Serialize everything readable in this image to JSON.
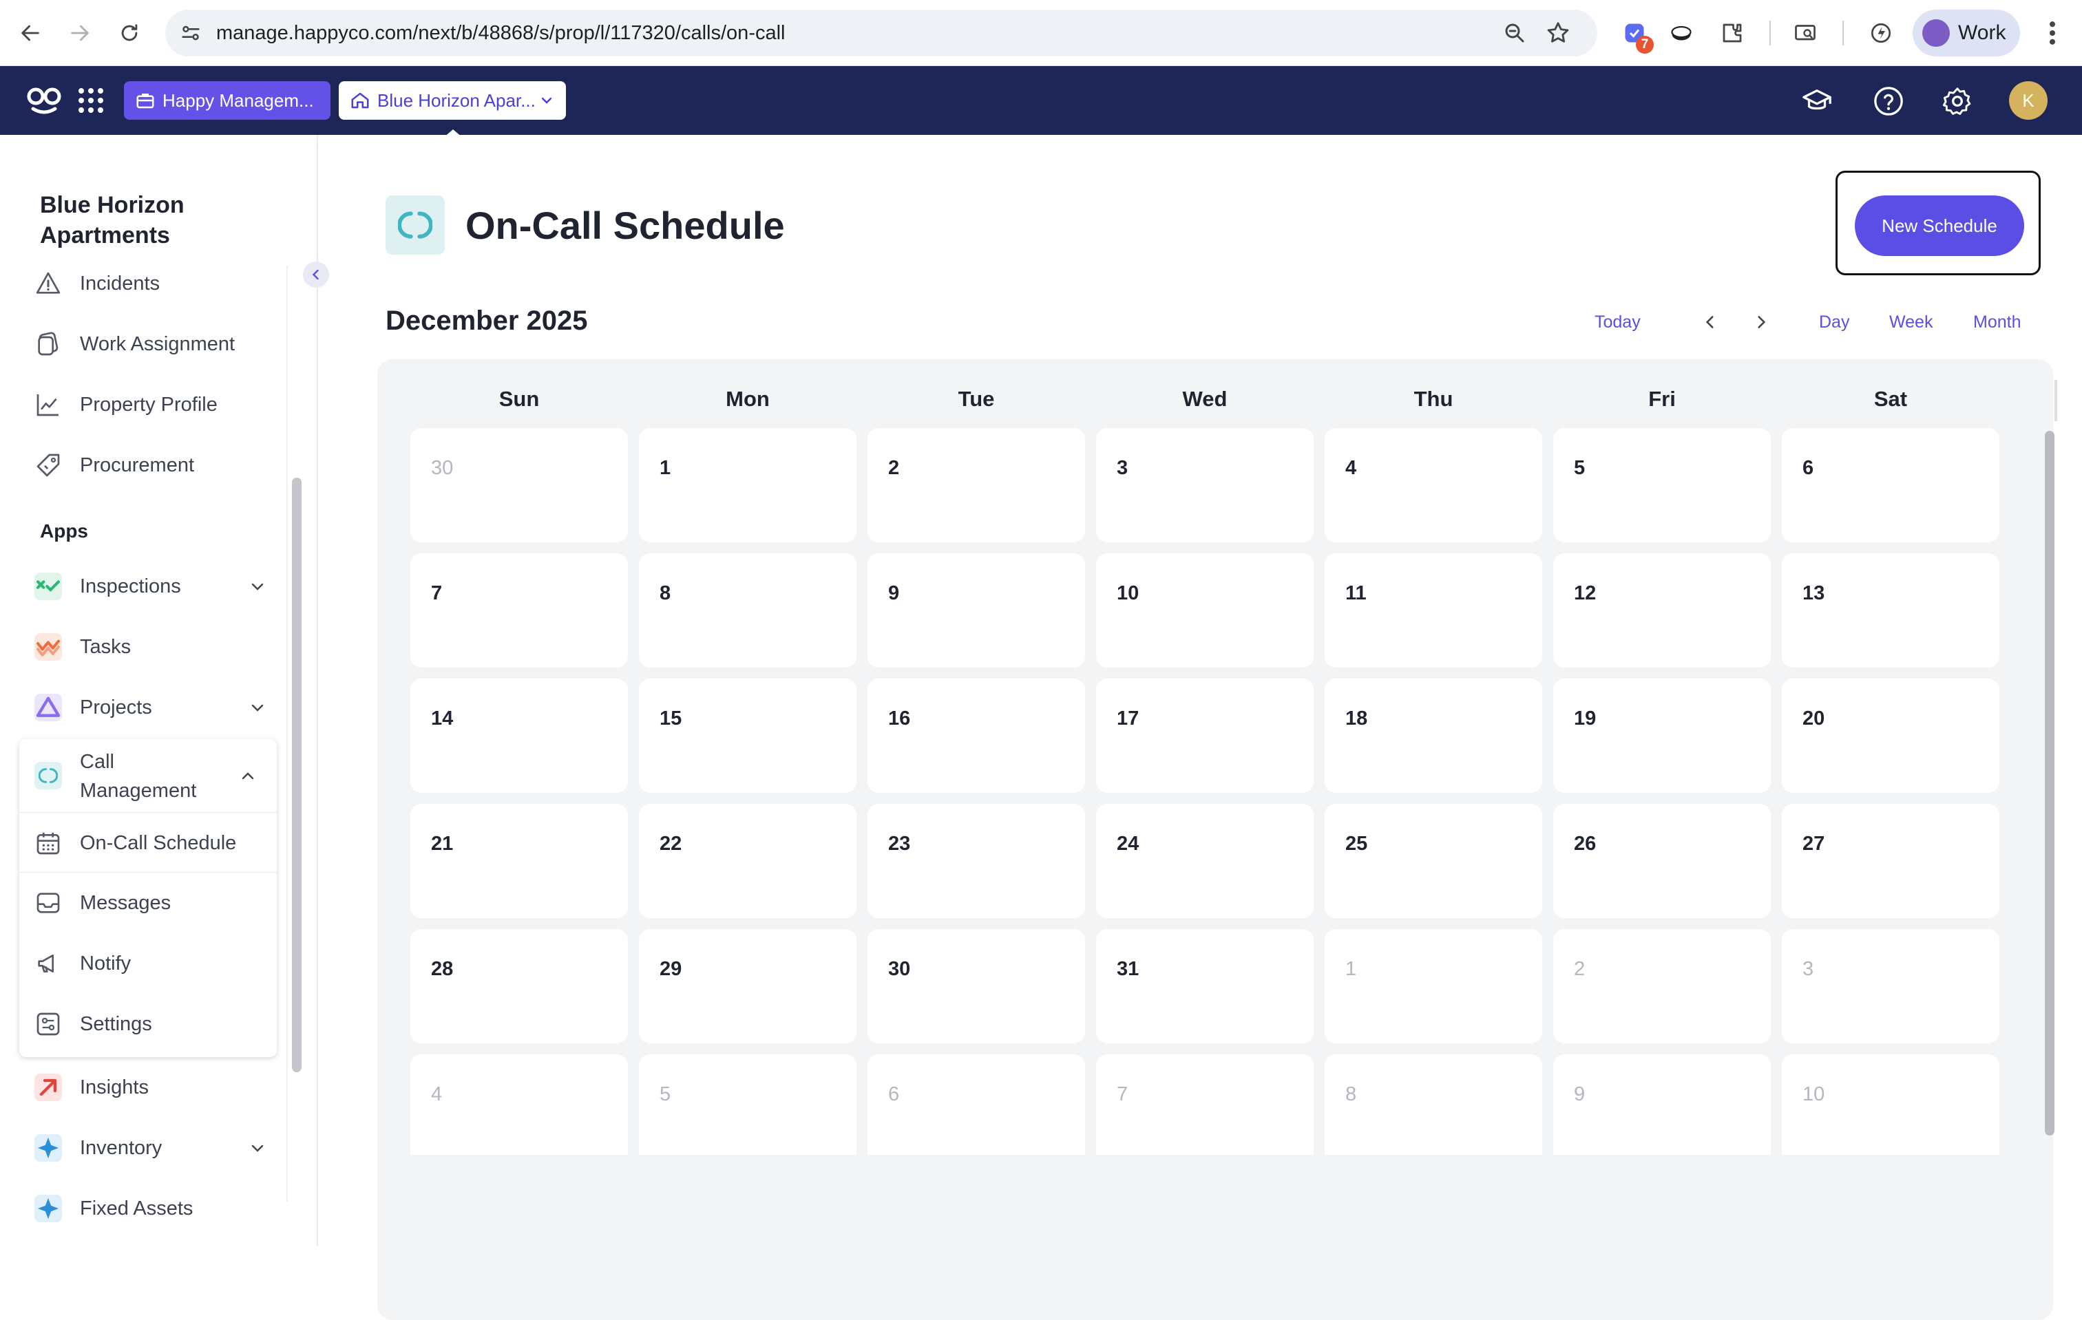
{
  "browser": {
    "url": "manage.happyco.com/next/b/48868/s/prop/l/117320/calls/on-call",
    "extension_badge": "7",
    "profile_label": "Work"
  },
  "header": {
    "company_chip": "Happy Managem...",
    "property_chip": "Blue Horizon Apar...",
    "avatar_initial": "K"
  },
  "sidebar": {
    "property_name": "Blue Horizon Apartments",
    "top_items": [
      {
        "label": "Incidents",
        "icon": "warning-icon"
      },
      {
        "label": "Work Assignment",
        "icon": "work-assignment-icon"
      },
      {
        "label": "Property Profile",
        "icon": "chart-icon"
      },
      {
        "label": "Procurement",
        "icon": "price-tag-icon"
      }
    ],
    "apps_heading": "Apps",
    "apps": [
      {
        "label": "Inspections",
        "icon": "inspections-icon",
        "color": "#2bb673"
      },
      {
        "label": "Tasks",
        "icon": "tasks-icon",
        "color": "#f26b3a"
      },
      {
        "label": "Projects",
        "icon": "projects-icon",
        "color": "#8a6cf0"
      },
      {
        "label": "Insights",
        "icon": "insights-icon",
        "color": "#e0443e"
      },
      {
        "label": "Inventory",
        "icon": "inventory-icon",
        "color": "#2a8fd6"
      },
      {
        "label": "Fixed Assets",
        "icon": "fixed-assets-icon",
        "color": "#2a8fd6"
      }
    ],
    "call_management": {
      "label": "Call Management",
      "sub_items": [
        {
          "label": "On-Call Schedule",
          "icon": "calendar-icon",
          "active": true
        },
        {
          "label": "Messages",
          "icon": "inbox-icon"
        },
        {
          "label": "Notify",
          "icon": "megaphone-icon"
        },
        {
          "label": "Settings",
          "icon": "settings-sliders-icon"
        }
      ]
    }
  },
  "main": {
    "title": "On-Call Schedule",
    "new_schedule_label": "New Schedule",
    "month_label": "December 2025",
    "today_label": "Today",
    "views": [
      "Day",
      "Week",
      "Month"
    ],
    "weekdays": [
      "Sun",
      "Mon",
      "Tue",
      "Wed",
      "Thu",
      "Fri",
      "Sat"
    ],
    "weeks": [
      [
        {
          "d": "30",
          "m": true
        },
        {
          "d": "1"
        },
        {
          "d": "2"
        },
        {
          "d": "3"
        },
        {
          "d": "4"
        },
        {
          "d": "5"
        },
        {
          "d": "6"
        }
      ],
      [
        {
          "d": "7"
        },
        {
          "d": "8"
        },
        {
          "d": "9"
        },
        {
          "d": "10"
        },
        {
          "d": "11"
        },
        {
          "d": "12"
        },
        {
          "d": "13"
        }
      ],
      [
        {
          "d": "14"
        },
        {
          "d": "15"
        },
        {
          "d": "16"
        },
        {
          "d": "17"
        },
        {
          "d": "18"
        },
        {
          "d": "19"
        },
        {
          "d": "20"
        }
      ],
      [
        {
          "d": "21"
        },
        {
          "d": "22"
        },
        {
          "d": "23"
        },
        {
          "d": "24"
        },
        {
          "d": "25"
        },
        {
          "d": "26"
        },
        {
          "d": "27"
        }
      ],
      [
        {
          "d": "28"
        },
        {
          "d": "29"
        },
        {
          "d": "30"
        },
        {
          "d": "31"
        },
        {
          "d": "1",
          "m": true
        },
        {
          "d": "2",
          "m": true
        },
        {
          "d": "3",
          "m": true
        }
      ],
      [
        {
          "d": "4",
          "m": true
        },
        {
          "d": "5",
          "m": true
        },
        {
          "d": "6",
          "m": true
        },
        {
          "d": "7",
          "m": true
        },
        {
          "d": "8",
          "m": true
        },
        {
          "d": "9",
          "m": true
        },
        {
          "d": "10",
          "m": true
        }
      ]
    ]
  },
  "colors": {
    "accent": "#5b4ee5",
    "header_bg": "#1d2656",
    "call_mgmt_teal": "#3fb6c1"
  }
}
